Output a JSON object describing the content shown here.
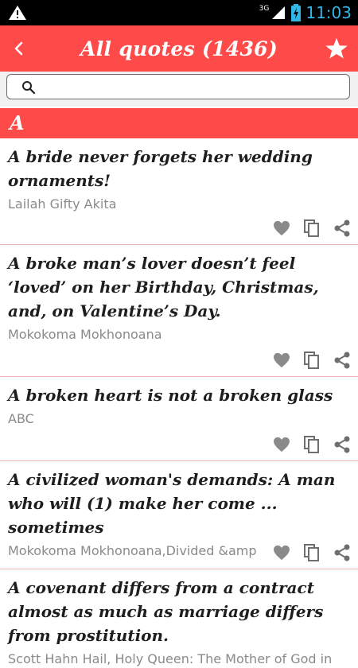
{
  "status_bar": {
    "time": "11:03",
    "signal_label": "3G",
    "icons": [
      "warning-icon",
      "signal-icon",
      "battery-icon"
    ]
  },
  "action_bar": {
    "title": "All quotes (1436)",
    "back_icon": "chevron-left-icon",
    "favorite_icon": "star-icon",
    "color": "#ff4a4a"
  },
  "search": {
    "placeholder": "",
    "value": "",
    "icon": "search-icon"
  },
  "section": {
    "letter": "A"
  },
  "quotes": [
    {
      "text": "A bride never forgets her wedding ornaments!",
      "author": "Lailah Gifty Akita"
    },
    {
      "text": "A broke man’s lover doesn’t feel ‘loved’ on her Birthday, Christmas, and, on Valentine’s Day.",
      "author": "Mokokoma Mokhonoana"
    },
    {
      "text": "A broken heart is not a broken glass",
      "author": "ABC"
    },
    {
      "text": "A civilized woman's demands: A man who will (1) make her come ... sometimes",
      "author": "Mokokoma Mokhonoana,Divided &amp"
    },
    {
      "text": "A covenant differs from a contract almost as much as marriage differs from prostitution.",
      "author": "Scott Hahn Hail, Holy Queen: The Mother of God in"
    }
  ],
  "item_actions": [
    "heart-icon",
    "copy-icon",
    "share-icon"
  ],
  "colors": {
    "accent": "#ff4a4a",
    "status_text": "#33b5e5",
    "action_icon": "#8a8a8a"
  }
}
